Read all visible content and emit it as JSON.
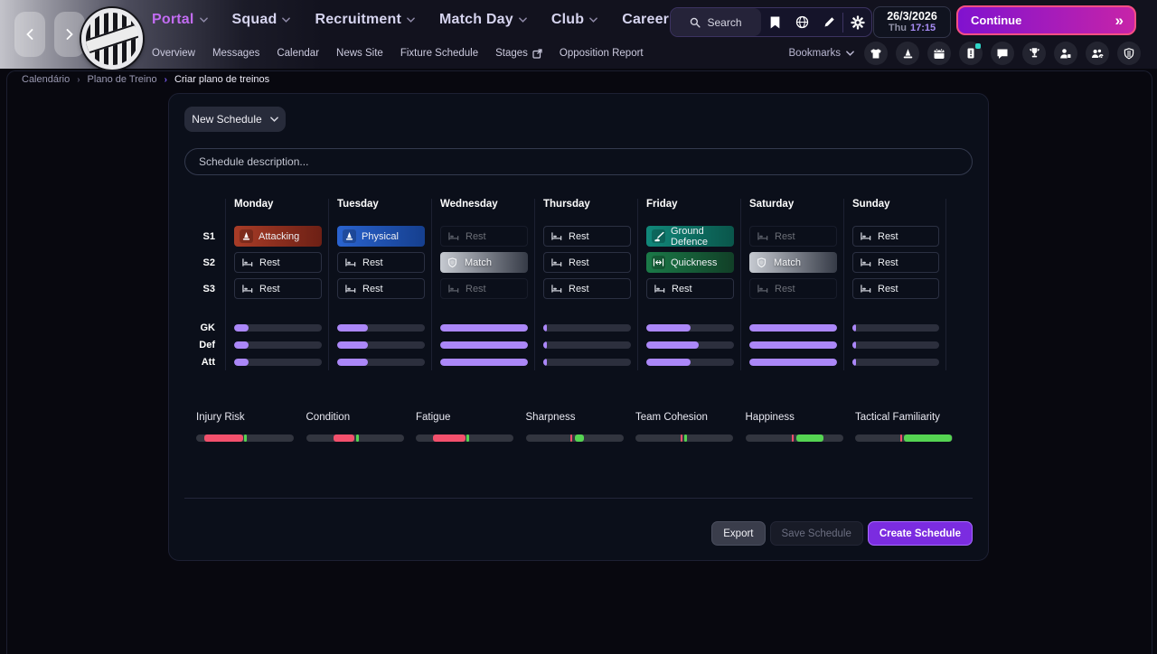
{
  "topbar": {
    "nav": [
      {
        "label": "Portal",
        "active": true
      },
      {
        "label": "Squad",
        "active": false
      },
      {
        "label": "Recruitment",
        "active": false
      },
      {
        "label": "Match Day",
        "active": false
      },
      {
        "label": "Club",
        "active": false
      },
      {
        "label": "Career",
        "active": false
      }
    ],
    "search_label": "Search",
    "toolbar_icons": [
      "bookmark-icon",
      "globe-icon",
      "pencil-icon",
      "gear-icon"
    ],
    "date": "26/3/2026",
    "weekday": "Thu",
    "time": "17:15",
    "continue_label": "Continue"
  },
  "subnav": {
    "items": [
      {
        "label": "Overview",
        "external": false
      },
      {
        "label": "Messages",
        "external": false
      },
      {
        "label": "Calendar",
        "external": false
      },
      {
        "label": "News Site",
        "external": false
      },
      {
        "label": "Fixture Schedule",
        "external": false
      },
      {
        "label": "Stages",
        "external": true
      },
      {
        "label": "Opposition Report",
        "external": false
      }
    ],
    "bookmarks_label": "Bookmarks",
    "quick_icons": [
      "jersey-icon",
      "training-cone-icon",
      "calendar-icon",
      "news-alert-icon",
      "chat-icon",
      "trophy-icon",
      "transfers-icon",
      "social-icon",
      "club-crest-icon"
    ]
  },
  "breadcrumb": [
    "Calendário",
    "Plano de Treino",
    "Criar plano de treinos"
  ],
  "panel": {
    "schedule_name": "New Schedule",
    "description_placeholder": "Schedule description...",
    "session_row_labels": [
      "S1",
      "S2",
      "S3"
    ],
    "intensity_row_labels": [
      "GK",
      "Def",
      "Att"
    ],
    "days": [
      {
        "name": "Monday",
        "sessions": [
          {
            "label": "Attacking",
            "type": "attacking",
            "icon": "cone-icon"
          },
          {
            "label": "Rest",
            "type": "rest",
            "icon": "bed-icon"
          },
          {
            "label": "Rest",
            "type": "rest",
            "icon": "bed-icon"
          }
        ],
        "intensity": [
          16,
          16,
          16
        ]
      },
      {
        "name": "Tuesday",
        "sessions": [
          {
            "label": "Physical",
            "type": "physical",
            "icon": "cone-icon"
          },
          {
            "label": "Rest",
            "type": "rest",
            "icon": "bed-icon"
          },
          {
            "label": "Rest",
            "type": "rest",
            "icon": "bed-icon"
          }
        ],
        "intensity": [
          35,
          35,
          35
        ]
      },
      {
        "name": "Wednesday",
        "sessions": [
          {
            "label": "Rest",
            "type": "rest-dim",
            "icon": "bed-icon"
          },
          {
            "label": "Match",
            "type": "match",
            "icon": "shield-icon"
          },
          {
            "label": "Rest",
            "type": "rest-dim",
            "icon": "bed-icon"
          }
        ],
        "intensity": [
          100,
          100,
          100
        ]
      },
      {
        "name": "Thursday",
        "sessions": [
          {
            "label": "Rest",
            "type": "rest",
            "icon": "bed-icon"
          },
          {
            "label": "Rest",
            "type": "rest",
            "icon": "bed-icon"
          },
          {
            "label": "Rest",
            "type": "rest",
            "icon": "bed-icon"
          }
        ],
        "intensity": [
          4,
          4,
          4
        ]
      },
      {
        "name": "Friday",
        "sessions": [
          {
            "label": "Ground Defence",
            "type": "ground-defence",
            "icon": "slide-tackle-icon"
          },
          {
            "label": "Quickness",
            "type": "quickness",
            "icon": "double-arrow-icon"
          },
          {
            "label": "Rest",
            "type": "rest",
            "icon": "bed-icon"
          }
        ],
        "intensity": [
          50,
          60,
          50
        ]
      },
      {
        "name": "Saturday",
        "sessions": [
          {
            "label": "Rest",
            "type": "rest-dim",
            "icon": "bed-icon"
          },
          {
            "label": "Match",
            "type": "match",
            "icon": "shield-icon"
          },
          {
            "label": "Rest",
            "type": "rest-dim",
            "icon": "bed-icon"
          }
        ],
        "intensity": [
          100,
          100,
          100
        ]
      },
      {
        "name": "Sunday",
        "sessions": [
          {
            "label": "Rest",
            "type": "rest",
            "icon": "bed-icon"
          },
          {
            "label": "Rest",
            "type": "rest",
            "icon": "bed-icon"
          },
          {
            "label": "Rest",
            "type": "rest",
            "icon": "bed-icon"
          }
        ],
        "intensity": [
          4,
          4,
          4
        ]
      }
    ],
    "stats": [
      {
        "label": "Injury Risk",
        "segments": [
          {
            "color": "red",
            "start": 8,
            "end": 48
          },
          {
            "color": "green",
            "start": 49,
            "end": 52
          }
        ]
      },
      {
        "label": "Condition",
        "segments": [
          {
            "color": "red",
            "start": 28,
            "end": 50
          },
          {
            "color": "green",
            "start": 51,
            "end": 54
          }
        ]
      },
      {
        "label": "Fatigue",
        "segments": [
          {
            "color": "red",
            "start": 18,
            "end": 51
          },
          {
            "color": "green",
            "start": 52,
            "end": 55
          }
        ]
      },
      {
        "label": "Sharpness",
        "segments": [
          {
            "color": "red",
            "start": 46,
            "end": 48
          },
          {
            "color": "green",
            "start": 50,
            "end": 60
          }
        ]
      },
      {
        "label": "Team Cohesion",
        "segments": [
          {
            "color": "red",
            "start": 46,
            "end": 48
          },
          {
            "color": "green",
            "start": 50,
            "end": 53
          }
        ]
      },
      {
        "label": "Happiness",
        "segments": [
          {
            "color": "red",
            "start": 48,
            "end": 50
          },
          {
            "color": "green",
            "start": 52,
            "end": 80
          }
        ]
      },
      {
        "label": "Tactical Familiarity",
        "segments": [
          {
            "color": "red",
            "start": 46,
            "end": 48
          },
          {
            "color": "green",
            "start": 50,
            "end": 99
          }
        ]
      }
    ],
    "footer": {
      "export_label": "Export",
      "save_label": "Save Schedule",
      "create_label": "Create Schedule"
    }
  },
  "colors": {
    "accent_purple": "#7b2ce0",
    "nav_active": "#c26cf2",
    "continue_gradient": [
      "#8012cf",
      "#c724a8"
    ],
    "continue_border": "#f84f84",
    "time_text": "#a98df6",
    "intensity_fill": "#ab87f8",
    "stat_red": "#f3506c",
    "stat_green": "#55d452",
    "session_attacking": "#a83c27",
    "session_physical": "#2a63cf",
    "session_ground_defence": "#11887a",
    "session_quickness": "#1b7a48",
    "session_match": "#c6cad1"
  }
}
